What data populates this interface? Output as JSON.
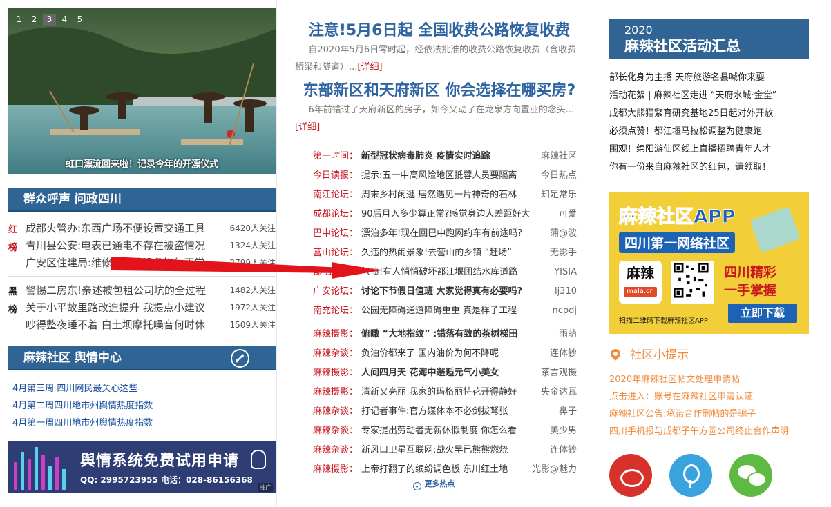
{
  "slider": {
    "dots": [
      "1",
      "2",
      "3",
      "4",
      "5"
    ],
    "active_index": 2,
    "caption": "虹口漂流回来啦！记录今年的开漂仪式"
  },
  "qunzhong": {
    "title": "群众呼声 问政四川",
    "red_tag": "红榜",
    "black_tag": "黑榜",
    "red": [
      {
        "title": "成都火管办:东西广场不便设置交通工具",
        "count": "6420人关注"
      },
      {
        "title": "青川县公安:电表已通电不存在被盗情况",
        "count": "1324人关注"
      },
      {
        "title": "广安区住建局:维修...消防设备恢复正常",
        "count": "2799人关注"
      }
    ],
    "black": [
      {
        "title": "警惕二房东!亲述被包租公司坑的全过程",
        "count": "1482人关注"
      },
      {
        "title": "关于小平故里路改造提升 我提点小建议",
        "count": "1972人关注"
      },
      {
        "title": "吵得整夜睡不着 白土坝摩托噪音何时休",
        "count": "1509人关注"
      }
    ]
  },
  "yuqing": {
    "title": "麻辣社区 舆情中心",
    "items": [
      "4月第三周 四川网民最关心这些",
      "4月第二周四川地市州舆情热度指数",
      "4月第一周四川地市州舆情热度指数"
    ]
  },
  "banner": {
    "title": "舆情系统免费试用申请",
    "sub": "QQ: 2995723955  电话：028-86156368",
    "ad": "推广"
  },
  "headlines": [
    {
      "title": "注意!5月6日起 全国收费公路恢复收费",
      "summary": "自2020年5月6日零时起，经依法批准的收费公路恢复收费（含收费桥梁和隧道）...",
      "more": "[详细]"
    },
    {
      "title": "东部新区和天府新区 你会选择在哪买房?",
      "summary": "6年前错过了天府新区的房子，如今又动了在龙泉方向置业的念头...",
      "more": "[详细]"
    }
  ],
  "news": [
    {
      "cat": "第一时间：",
      "title": "新型冠状病毒肺炎 疫情实时追踪",
      "author": "麻辣社区",
      "bold": true
    },
    {
      "cat": "今日读报：",
      "title": "提示:五一中高风险地区抵蓉人员要隔离",
      "author": "今日热点",
      "bold": false
    },
    {
      "cat": "南江论坛：",
      "title": "周末乡村闲逛 居然遇见一片神奇的石林",
      "author": "知足常乐",
      "bold": false
    },
    {
      "cat": "成都论坛：",
      "title": "90后月入多少算正常?感觉身边人差距好大",
      "author": "可爱",
      "bold": false
    },
    {
      "cat": "巴中论坛：",
      "title": "漂泊多年!现在回巴中跑网约车有前途吗?",
      "author": "蒲@波",
      "bold": false
    },
    {
      "cat": "营山论坛：",
      "title": "久违的热闹景象!去营山的乡镇 “赶场”",
      "author": "无影手",
      "bold": false
    },
    {
      "cat": "都 江 堰：",
      "title": "气愤!有人悄悄破坏都江堰团结水库道路",
      "author": "YISIA",
      "bold": false
    },
    {
      "cat": "广安论坛：",
      "title": "讨论下节假日值班 大家觉得真有必要吗?",
      "author": "lj310",
      "bold": true
    },
    {
      "cat": "南充论坛：",
      "title": "公园无障碍通道障碍重重 真是样子工程",
      "author": "ncpdj",
      "bold": false
    }
  ],
  "news2": [
    {
      "cat": "麻辣摄影：",
      "title": "俯瞰 “大地指纹” :错落有致的茶树梯田",
      "author": "雨萌",
      "bold": true
    },
    {
      "cat": "麻辣杂谈：",
      "title": "负油价都来了 国内油价为何不降呢",
      "author": "连体钞",
      "bold": false
    },
    {
      "cat": "麻辣摄影：",
      "title": "人间四月天 花海中邂逅元气小美女",
      "author": "茶言观摄",
      "bold": true
    },
    {
      "cat": "麻辣摄影：",
      "title": "清新又亮丽 我家的玛格丽特花开得静好",
      "author": "央金达瓦",
      "bold": false
    },
    {
      "cat": "麻辣杂谈：",
      "title": "打记者事件:官方媒体本不必剑拔弩张",
      "author": "鼻子",
      "bold": false
    },
    {
      "cat": "麻辣杂谈：",
      "title": "专家提出劳动者无薪休假制度 你怎么看",
      "author": "美少男",
      "bold": false
    },
    {
      "cat": "麻辣杂谈：",
      "title": "新风口卫星互联网:战火早已熊熊燃烧",
      "author": "连体钞",
      "bold": false
    },
    {
      "cat": "麻辣摄影：",
      "title": "上帝打翻了的缤纷调色板 东川红土地",
      "author": "光影@魅力",
      "bold": false
    }
  ],
  "more_hot": "更多热点",
  "activity": {
    "year": "2020",
    "title": "麻辣社区活动汇总",
    "items": [
      "部长化身为主播 天府旅游名县喊你来耍",
      "活动花絮 | 麻辣社区走进 “天府水城·金堂”",
      "成都大熊猫繁育研究基地25日起对外开放",
      "必须点赞！都江堰马拉松调整为健康跑",
      "围观！绵阳游仙区线上直播招聘青年人才",
      "你有一份来自麻辣社区的红包，请领取！"
    ]
  },
  "app_ad": {
    "title": "麻辣社区APP",
    "tagline": "四川第一网络社区",
    "logo_text": "麻辣",
    "logo_url": "mala.cn",
    "slogan1": "四川精彩",
    "slogan2": "一手掌握",
    "download": "立即下载",
    "caption": "扫描二维码下载麻辣社区APP"
  },
  "tips": {
    "title": "社区小提示",
    "items": [
      "2020年麻辣社区帖文处理申请帖",
      "点击进入：账号在麻辣社区申请认证",
      "麻辣社区公告:承诺合作删帖的是骗子",
      "四川手机报与成都子午方圆公司终止合作声明"
    ]
  },
  "social": [
    "weibo-icon",
    "podcast-icon",
    "wechat-icon"
  ],
  "colors": {
    "brand_blue": "#2f6495",
    "red": "#c8161d",
    "orange": "#f08c3e",
    "yellow": "#f2cf38"
  }
}
